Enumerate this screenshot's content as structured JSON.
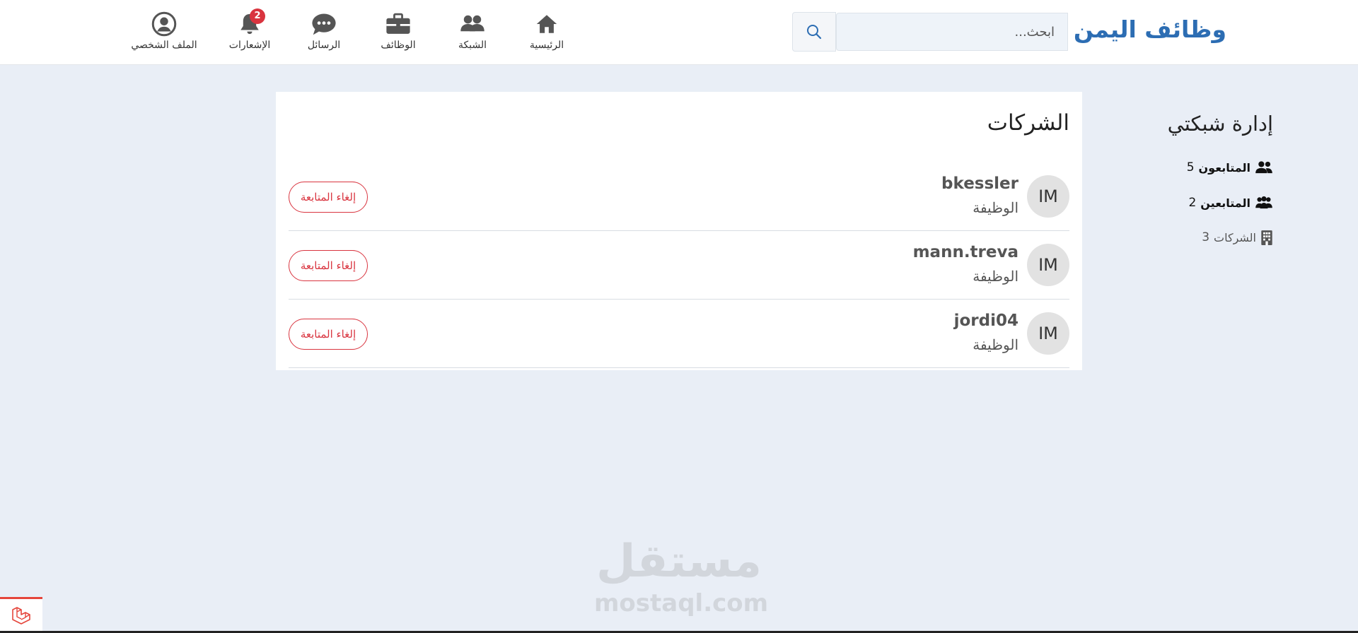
{
  "header": {
    "brand": "وظائف اليمن",
    "search": {
      "placeholder": "ابحث..."
    },
    "nav": [
      {
        "label": "الرئيسية",
        "icon": "home-icon"
      },
      {
        "label": "الشبكة",
        "icon": "users-icon"
      },
      {
        "label": "الوظائف",
        "icon": "briefcase-icon"
      },
      {
        "label": "الرسائل",
        "icon": "chat-icon"
      },
      {
        "label": "الإشعارات",
        "icon": "bell-icon",
        "badge": "2"
      },
      {
        "label": "الملف الشخصي",
        "icon": "user-circle-icon"
      }
    ]
  },
  "sidebar": {
    "title": "إدارة شبكتي",
    "links": [
      {
        "label": "المتابعون",
        "count": "5",
        "icon": "user-group-icon"
      },
      {
        "label": "المتابعين",
        "count": "2",
        "icon": "users-friends-icon"
      },
      {
        "label": "الشركات",
        "count": "3",
        "icon": "building-icon"
      }
    ]
  },
  "main": {
    "title": "الشركات",
    "companies": [
      {
        "initials": "IM",
        "name": "bkessler",
        "job": "الوظيفة",
        "action": "إلغاء المتابعة"
      },
      {
        "initials": "IM",
        "name": "mann.treva",
        "job": "الوظيفة",
        "action": "إلغاء المتابعة"
      },
      {
        "initials": "IM",
        "name": "jordi04",
        "job": "الوظيفة",
        "action": "إلغاء المتابعة"
      }
    ]
  },
  "watermark": {
    "arabic": "مستقل",
    "latin": "mostaql.com"
  },
  "colors": {
    "brand": "#2c6db3",
    "danger": "#d9343f",
    "background": "#e9eef6"
  }
}
